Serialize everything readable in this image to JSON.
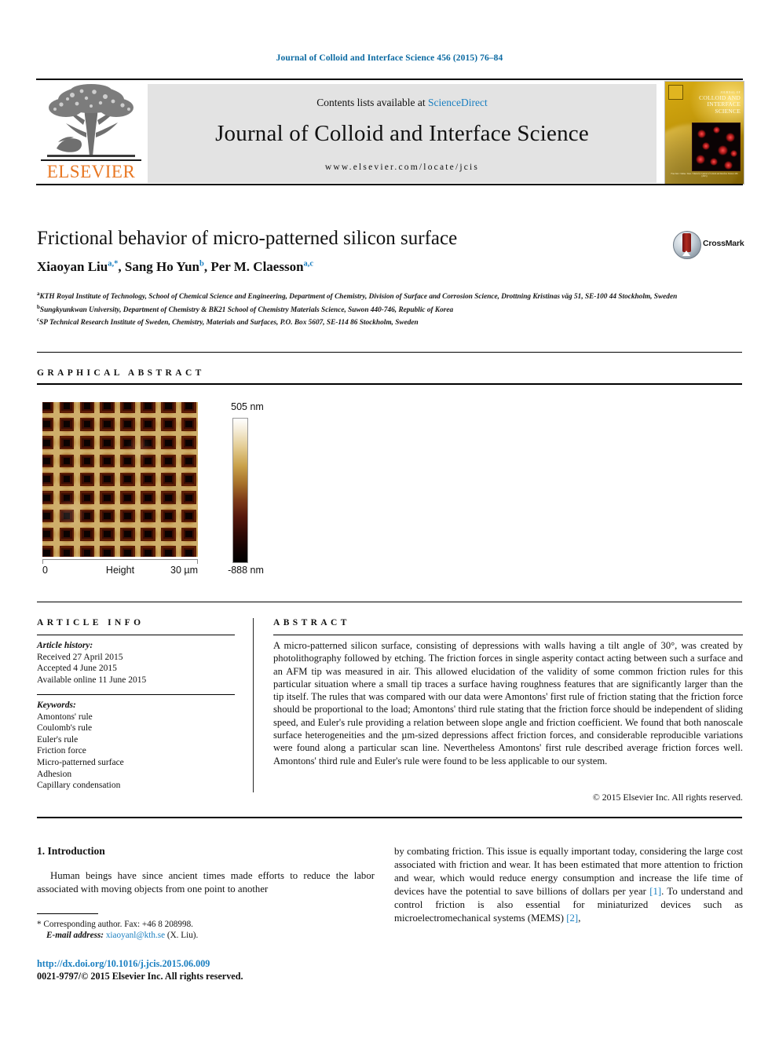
{
  "running_head": "Journal of Colloid and Interface Science 456 (2015) 76–84",
  "masthead": {
    "contents_prefix": "Contents lists available at ",
    "sciencedirect": "ScienceDirect",
    "journal_name": "Journal of Colloid and Interface Science",
    "url": "www.elsevier.com/locate/jcis",
    "publisher": "ELSEVIER",
    "cover": {
      "kicker": "JOURNAL OF",
      "line1": "COLLOID AND",
      "line2": "INTERFACE",
      "line3": "SCIENCE",
      "caption": "Free Text / Tables / Data / Charts for Journal of Colloid and Interface Science 456 (2015)"
    }
  },
  "article": {
    "title": "Frictional behavior of micro-patterned silicon surface",
    "crossmark_label": "CrossMark",
    "authors": [
      {
        "name": "Xiaoyan Liu",
        "marks": "a,*"
      },
      {
        "name": "Sang Ho Yun",
        "marks": "b"
      },
      {
        "name": "Per M. Claesson",
        "marks": "a,c"
      }
    ],
    "affiliations": [
      {
        "mark": "a",
        "text": "KTH Royal Institute of Technology, School of Chemical Science and Engineering, Department of Chemistry, Division of Surface and Corrosion Science, Drottning Kristinas väg 51, SE-100 44 Stockholm, Sweden"
      },
      {
        "mark": "b",
        "text": "Sungkyunkwan University, Department of Chemistry & BK21 School of Chemistry Materials Science, Suwon 440-746, Republic of Korea"
      },
      {
        "mark": "c",
        "text": "SP Technical Research Institute of Sweden, Chemistry, Materials and Surfaces, P.O. Box 5607, SE-114 86 Stockholm, Sweden"
      }
    ]
  },
  "graphical_abstract": {
    "heading": "GRAPHICAL ABSTRACT",
    "afm": {
      "x_min_label": "0",
      "x_mid_label": "Height",
      "x_max_label": "30 µm",
      "colorbar_max": "505 nm",
      "colorbar_min": "-888 nm",
      "grid_cols": 8,
      "grid_rows": 9
    }
  },
  "article_info": {
    "heading": "ARTICLE INFO",
    "history_label": "Article history:",
    "history": [
      "Received 27 April 2015",
      "Accepted 4 June 2015",
      "Available online 11 June 2015"
    ],
    "keywords_label": "Keywords:",
    "keywords": [
      "Amontons' rule",
      "Coulomb's rule",
      "Euler's rule",
      "Friction force",
      "Micro-patterned surface",
      "Adhesion",
      "Capillary condensation"
    ]
  },
  "abstract": {
    "heading": "ABSTRACT",
    "text": "A micro-patterned silicon surface, consisting of depressions with walls having a tilt angle of 30°, was created by photolithography followed by etching. The friction forces in single asperity contact acting between such a surface and an AFM tip was measured in air. This allowed elucidation of the validity of some common friction rules for this particular situation where a small tip traces a surface having roughness features that are significantly larger than the tip itself. The rules that was compared with our data were Amontons' first rule of friction stating that the friction force should be proportional to the load; Amontons' third rule stating that the friction force should be independent of sliding speed, and Euler's rule providing a relation between slope angle and friction coefficient. We found that both nanoscale surface heterogeneities and the µm-sized depressions affect friction forces, and considerable reproducible variations were found along a particular scan line. Nevertheless Amontons' first rule described average friction forces well. Amontons' third rule and Euler's rule were found to be less applicable to our system.",
    "copyright": "© 2015 Elsevier Inc. All rights reserved."
  },
  "body": {
    "section_heading": "1. Introduction",
    "left_paragraph": "Human beings have since ancient times made efforts to reduce the labor associated with moving objects from one point to another",
    "right_paragraph_part1": "by combating friction. This issue is equally important today, considering the large cost associated with friction and wear. It has been estimated that more attention to friction and wear, which would reduce energy consumption and increase the life time of devices have the potential to save billions of dollars per year ",
    "right_ref1": "[1]",
    "right_paragraph_part2": ". To understand and control friction is also essential for miniaturized devices such as microelectromechanical systems (MEMS) ",
    "right_ref2": "[2]",
    "right_paragraph_part3": ","
  },
  "footer": {
    "corresponding_marker": "*",
    "corresponding": "Corresponding author. Fax: +46 8 208998.",
    "email_label": "E-mail address:",
    "email": "xiaoyanl@kth.se",
    "email_suffix": "(X. Liu).",
    "doi": "http://dx.doi.org/10.1016/j.jcis.2015.06.009",
    "issn": "0021-9797/© 2015 Elsevier Inc. All rights reserved."
  }
}
